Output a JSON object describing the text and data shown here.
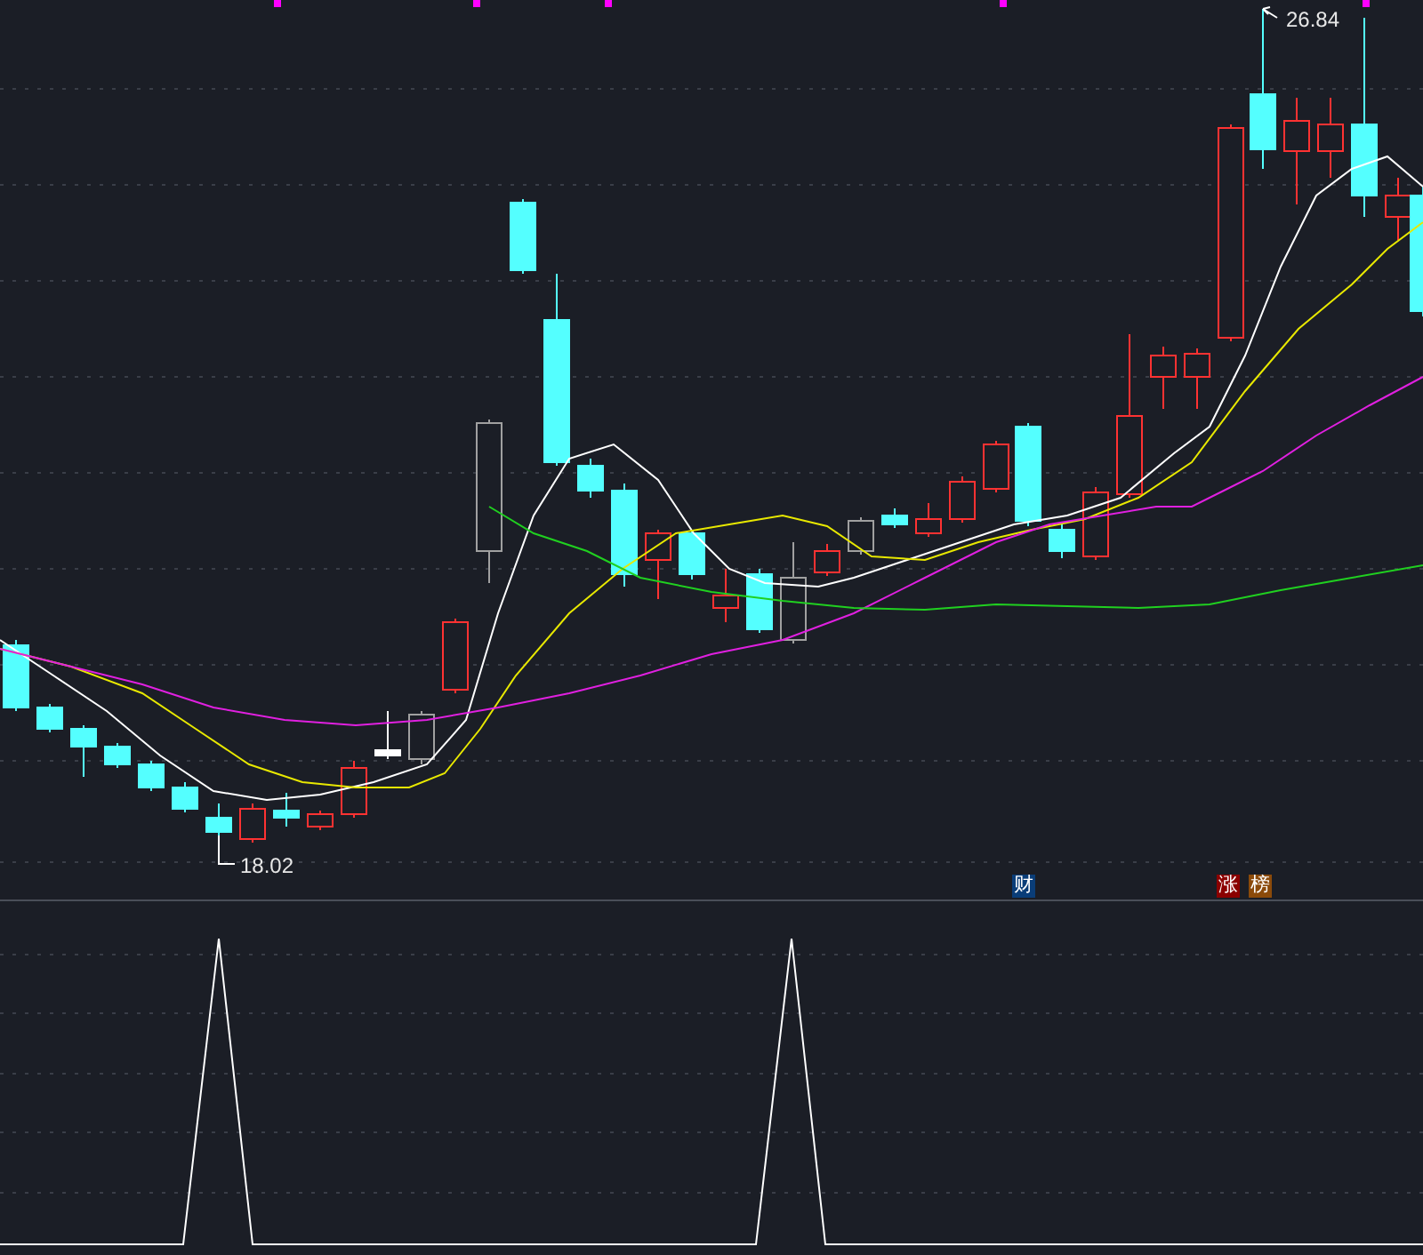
{
  "price_panel": {
    "high_label": "26.84",
    "low_label": "18.02",
    "event_badges": [
      {
        "text": "财",
        "color": "#0a3d78"
      },
      {
        "text": "涨",
        "color": "#8b0000"
      },
      {
        "text": "榜",
        "color": "#8b4a0a"
      }
    ]
  }
}
